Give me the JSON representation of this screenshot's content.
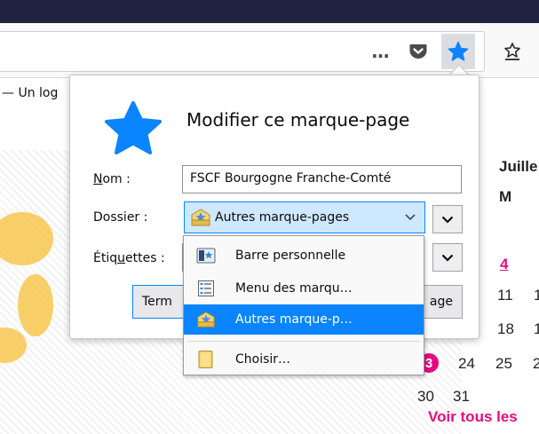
{
  "page": {
    "tab_text": "— Un log",
    "calendar": {
      "month": "Juille",
      "weekday": "M",
      "days": [
        "4",
        "11",
        "1",
        "18",
        "1",
        "24",
        "25",
        "2",
        "30",
        "31"
      ],
      "highlight_day": "3",
      "see_all": "Voir tous les"
    }
  },
  "toolbar": {
    "overflow_icon": "…",
    "pocket_icon": "pocket-icon",
    "bookmark_star_icon": "star-icon",
    "library_icon": "library-icon"
  },
  "panel": {
    "title": "Modifier ce marque-page",
    "name_label_u": "N",
    "name_label_rest": "om :",
    "name_value": "FSCF Bourgogne Franche-Comté",
    "folder_label": "Dossier :",
    "folder_value": "Autres marque-pages",
    "tags_label_pre": "Étiq",
    "tags_label_u": "u",
    "tags_label_post": "ettes :",
    "done_button_partial": "Term",
    "remove_button_partial": "age"
  },
  "dropdown": {
    "items": [
      {
        "label": "Barre personnelle",
        "icon": "bookmarks-toolbar-icon"
      },
      {
        "label": "Menu des marqu…",
        "icon": "bookmarks-menu-icon"
      },
      {
        "label": "Autres marque-p…",
        "icon": "other-bookmarks-icon",
        "selected": true
      },
      {
        "label": "Choisir…",
        "icon": "folder-icon"
      }
    ]
  },
  "colors": {
    "accent": "#0a84ff",
    "brand_pink": "#e5097f",
    "titlebar": "#202340"
  }
}
